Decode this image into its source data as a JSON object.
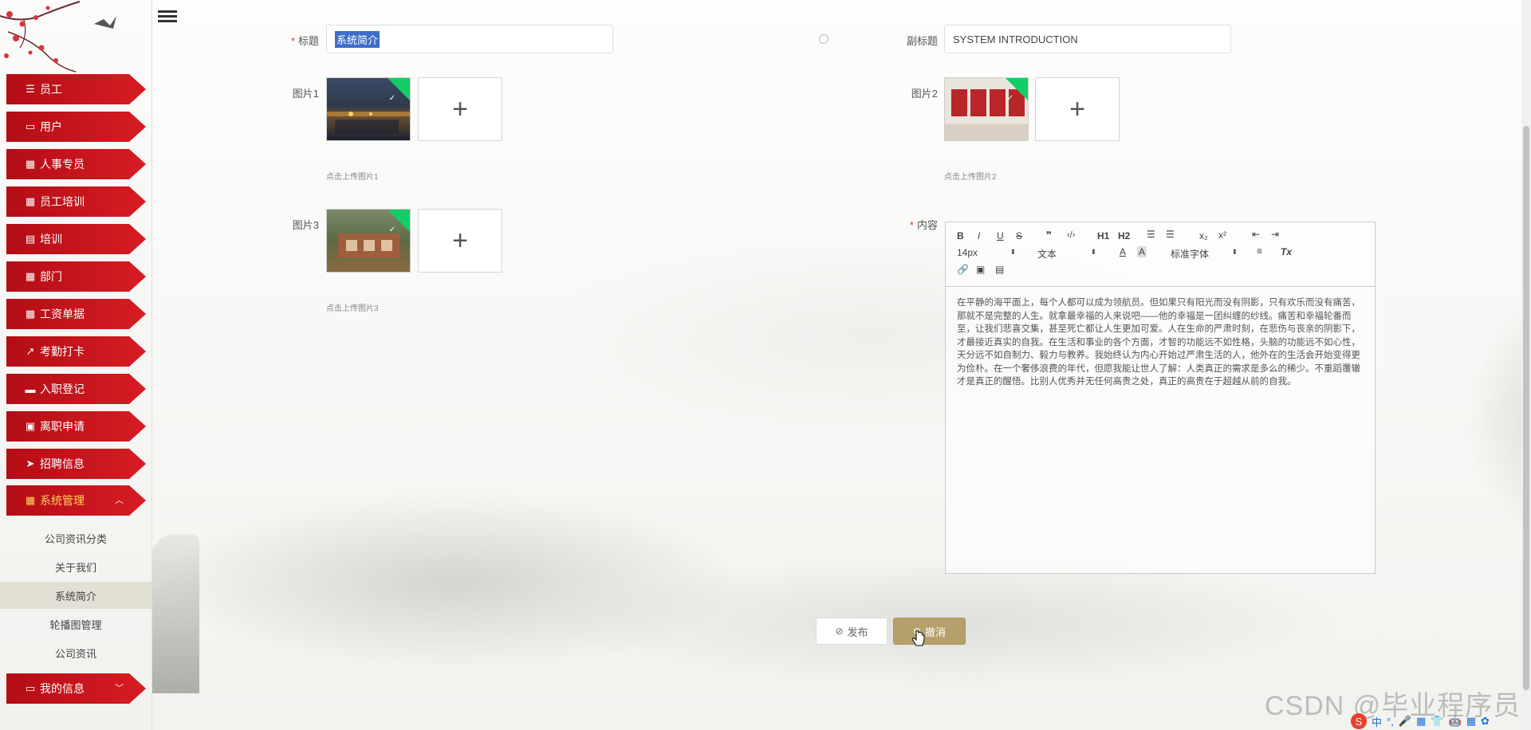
{
  "sidebar": {
    "menu": [
      {
        "label": "员工",
        "icon": "list-icon"
      },
      {
        "label": "用户",
        "icon": "monitor-icon"
      },
      {
        "label": "人事专员",
        "icon": "grid-icon"
      },
      {
        "label": "员工培训",
        "icon": "grid-icon"
      },
      {
        "label": "培训",
        "icon": "chat-icon"
      },
      {
        "label": "部门",
        "icon": "grid-icon"
      },
      {
        "label": "工资单据",
        "icon": "grid-icon"
      },
      {
        "label": "考勤打卡",
        "icon": "chart-icon"
      },
      {
        "label": "入职登记",
        "icon": "inbox-icon"
      },
      {
        "label": "离职申请",
        "icon": "clipboard-icon"
      },
      {
        "label": "招聘信息",
        "icon": "send-icon"
      },
      {
        "label": "系统管理",
        "icon": "grid-icon",
        "expanded": true
      },
      {
        "label": "我的信息",
        "icon": "card-icon",
        "expanded": false
      }
    ],
    "submenu": [
      "公司资讯分类",
      "关于我们",
      "系统简介",
      "轮播图管理",
      "公司资讯"
    ],
    "submenu_selected": "系统简介"
  },
  "form": {
    "title_label": "标题",
    "title_value": "系统简介",
    "subtitle_label": "副标题",
    "subtitle_value": "SYSTEM INTRODUCTION",
    "image1_label": "图片1",
    "image1_hint": "点击上传图片1",
    "image2_label": "图片2",
    "image2_hint": "点击上传图片2",
    "image3_label": "图片3",
    "image3_hint": "点击上传图片3",
    "content_label": "内容",
    "uploader_symbol": "+"
  },
  "editor": {
    "toolbar": {
      "bold": "B",
      "italic": "I",
      "underline": "U",
      "strike": "S",
      "quote": "❞",
      "code": "‹/›",
      "h1": "H1",
      "h2": "H2",
      "sub": "x₂",
      "sup": "x²",
      "size": "14px",
      "format": "文本",
      "font": "标准字体",
      "clear": "Tx"
    },
    "content": "在平静的海平面上，每个人都可以成为领航员。但如果只有阳光而没有阴影，只有欢乐而没有痛苦，那就不是完整的人生。就拿最幸福的人来说吧——他的幸福是一团纠缠的纱线。痛苦和幸福轮番而至，让我们悲喜交集，甚至死亡都让人生更加可爱。人在生命的严肃时刻，在悲伤与丧亲的阴影下，才最接近真实的自我。在生活和事业的各个方面，才智的功能远不如性格，头脑的功能远不如心性，天分远不如自制力、毅力与教养。我始终认为内心开始过严肃生活的人，他外在的生活会开始变得更为俭朴。在一个奢侈浪费的年代，但愿我能让世人了解：人类真正的需求是多么的稀少。不重蹈覆辙才是真正的醒悟。比别人优秀并无任何高贵之处，真正的高贵在于超越从前的自我。"
  },
  "buttons": {
    "publish": "发布",
    "cancel": "撤消"
  },
  "watermark": "CSDN @毕业程序员",
  "tray": {
    "logo": "S",
    "items": [
      "中",
      "°,",
      "🎤",
      "▦",
      "👕",
      "🤖",
      "▦",
      "✿"
    ]
  }
}
